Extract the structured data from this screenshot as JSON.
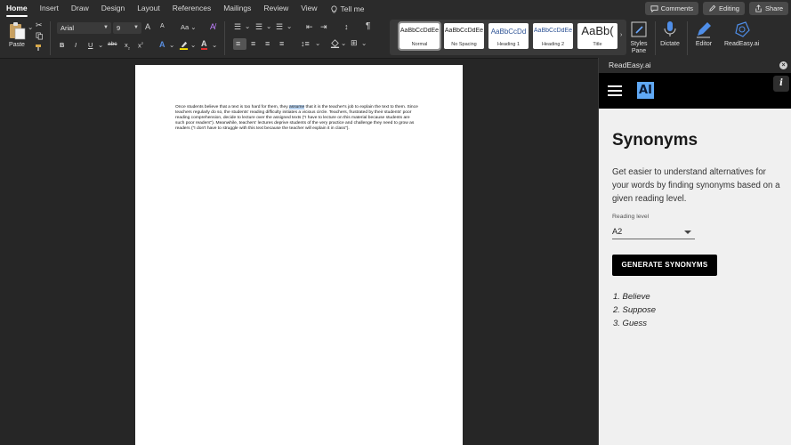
{
  "ribbon_tabs": [
    "Home",
    "Insert",
    "Draw",
    "Design",
    "Layout",
    "References",
    "Mailings",
    "Review",
    "View"
  ],
  "tell_me": "Tell me",
  "top_buttons": {
    "comments": "Comments",
    "editing": "Editing",
    "share": "Share"
  },
  "clipboard": {
    "paste_label": "Paste"
  },
  "font": {
    "name": "Arial",
    "size": "9",
    "grow": "A",
    "shrink": "A",
    "case": "Aa"
  },
  "format_buttons": {
    "bold": "B",
    "italic": "I",
    "underline": "U",
    "strike": "abc",
    "subscript": "x",
    "superscript": "x"
  },
  "styles": [
    {
      "sample": "AaBbCcDdEe",
      "name": "Normal"
    },
    {
      "sample": "AaBbCcDdEe",
      "name": "No Spacing"
    },
    {
      "sample": "AaBbCcDd",
      "name": "Heading 1"
    },
    {
      "sample": "AaBbCcDdEe",
      "name": "Heading 2"
    },
    {
      "sample": "AaBb(",
      "name": "Title"
    }
  ],
  "right_buttons": {
    "styles_pane": "Styles Pane",
    "dictate": "Dictate",
    "editor": "Editor",
    "readeasy": "ReadEasy.ai"
  },
  "document": {
    "before": "Once students believe that a text is too hard for them, they ",
    "highlight": "assume",
    "after": " that it is the teacher's job to explain the text to them. Since teachers regularly do so, the students' reading difficulty initiates a vicious circle. Teachers, frustrated by their students' poor reading comprehension, decide to lecture over the assigned texts (\"I have to lecture on this material because students are such poor readers\"). Meanwhile, teachers' lectures deprive students of the very practice and challenge they need to grow as readers (\"I don't have to struggle with this text because the teacher will explain it in class\")."
  },
  "panel": {
    "title": "ReadEasy.ai",
    "logo_text": "AI",
    "info": "i",
    "heading": "Synonyms",
    "description": "Get easier to understand alternatives for your words by finding synonyms based on a given reading level.",
    "reading_level_label": "Reading level",
    "reading_level_value": "A2",
    "generate_button": "GENERATE SYNONYMS",
    "synonyms": [
      "1. Believe",
      "2. Suppose",
      "3. Guess"
    ]
  }
}
